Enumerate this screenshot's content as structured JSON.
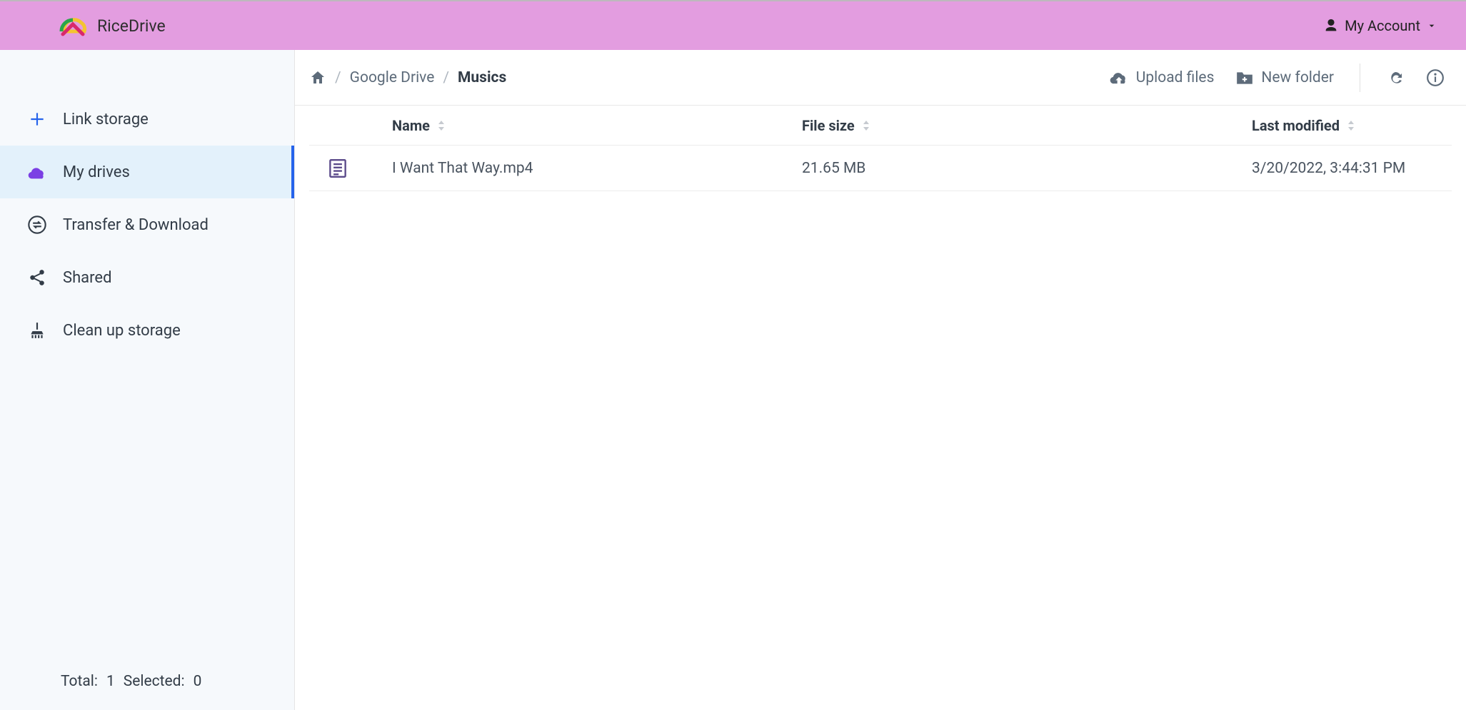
{
  "brand": {
    "name": "RiceDrive"
  },
  "account": {
    "label": "My Account"
  },
  "sidebar": {
    "items": [
      {
        "label": "Link storage"
      },
      {
        "label": "My drives"
      },
      {
        "label": "Transfer & Download"
      },
      {
        "label": "Shared"
      },
      {
        "label": "Clean up storage"
      }
    ],
    "footer": {
      "total_label": "Total:",
      "total_value": "1",
      "selected_label": "Selected:",
      "selected_value": "0"
    }
  },
  "breadcrumb": {
    "drive": "Google Drive",
    "current": "Musics"
  },
  "toolbar": {
    "upload_label": "Upload files",
    "newfolder_label": "New folder"
  },
  "columns": {
    "name": "Name",
    "size": "File size",
    "modified": "Last modified"
  },
  "rows": [
    {
      "name": "I Want That Way.mp4",
      "size": "21.65 MB",
      "modified": "3/20/2022, 3:44:31 PM"
    }
  ]
}
